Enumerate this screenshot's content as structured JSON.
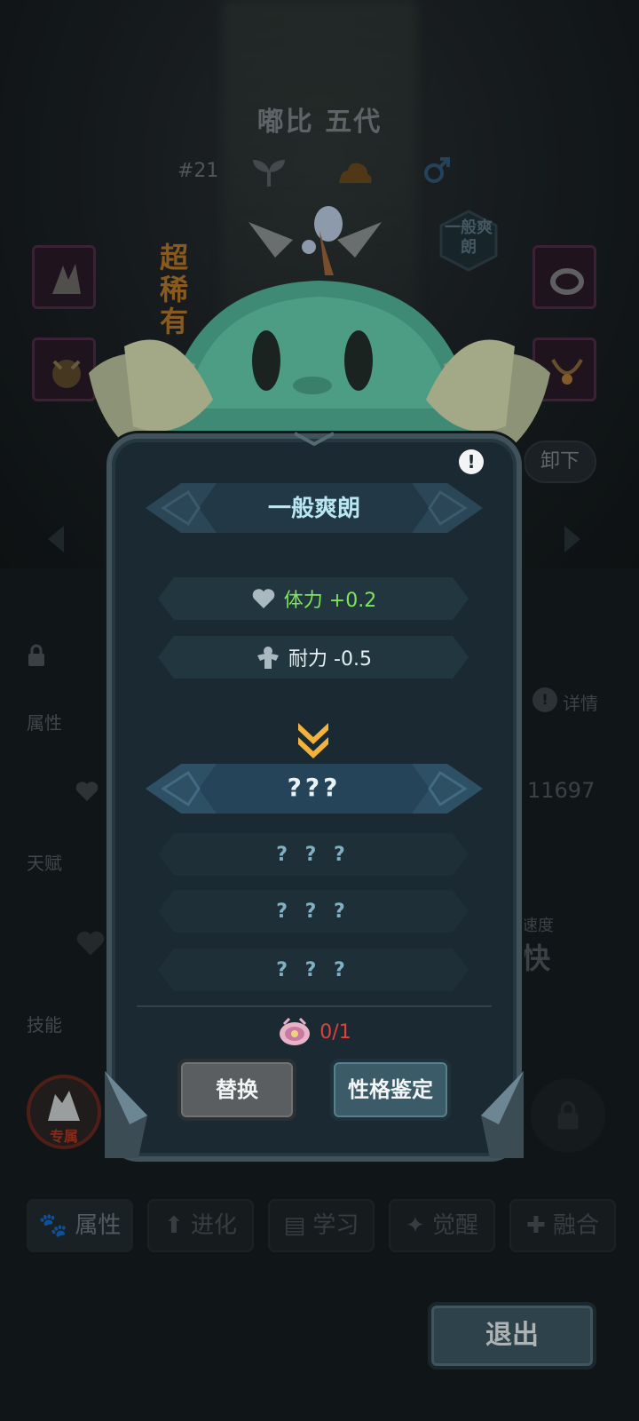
{
  "pet": {
    "name": "嘟比 五代",
    "number": "#21",
    "rarity": "超稀有",
    "personality_badge": "一般爽朗"
  },
  "background": {
    "unequip_label": "卸下",
    "attributes_label": "属性",
    "talent_label": "天赋",
    "skills_label": "技能",
    "details_label": "详情",
    "hp_value": "11697",
    "speed_label": "速度",
    "speed_value": "快",
    "exclusive_label": "专属"
  },
  "tabs": [
    {
      "label": "属性",
      "icon": "paw-icon"
    },
    {
      "label": "进化",
      "icon": "evolve-arrow-icon"
    },
    {
      "label": "学习",
      "icon": "book-icon"
    },
    {
      "label": "觉醒",
      "icon": "beast-icon"
    },
    {
      "label": "融合",
      "icon": "fusion-icon"
    }
  ],
  "exit_label": "退出",
  "modal": {
    "title": "一般爽朗",
    "current_stats": [
      {
        "icon": "heart-icon",
        "text": "体力 +0.2",
        "color": "#7ee55a"
      },
      {
        "icon": "muscle-icon",
        "text": "耐力 -0.5",
        "color": "#e6eef1"
      }
    ],
    "new_title": "???",
    "new_stats": [
      "? ? ?",
      "? ? ?",
      "? ? ?"
    ],
    "item_count": "0/1",
    "replace_label": "替换",
    "appraise_label": "性格鉴定"
  }
}
